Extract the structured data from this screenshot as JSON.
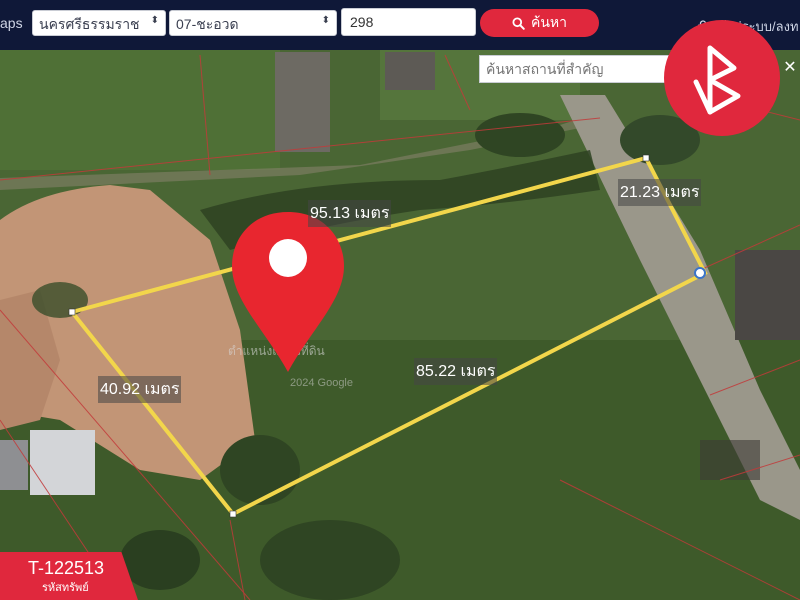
{
  "header": {
    "brand": "aps",
    "province": "นครศรีธรรมราช",
    "district": "07-ชะอวด",
    "parcel_number": "298",
    "search_label": "ค้นหา",
    "login_label": "เข้าสู่ระบบ/ลงท"
  },
  "map": {
    "place_search_placeholder": "ค้นหาสถานที่สำคัญ",
    "close_symbol": "✕",
    "measurements": {
      "top": "95.13 เมตร",
      "right": "21.23 เมตร",
      "bottom": "85.22 เมตร",
      "left": "40.92 เมตร"
    },
    "parcel_outline_color": "#f2d64b",
    "pin_color": "#e8262f",
    "watermark_text": "ตำแหน่งแปลงที่ดิน",
    "watermark_credit": "2024 Google"
  },
  "listing": {
    "code": "T-122513",
    "code_caption": "รหัสทรัพย์"
  },
  "colors": {
    "topbar": "#0f1838",
    "accent": "#e0283d"
  }
}
